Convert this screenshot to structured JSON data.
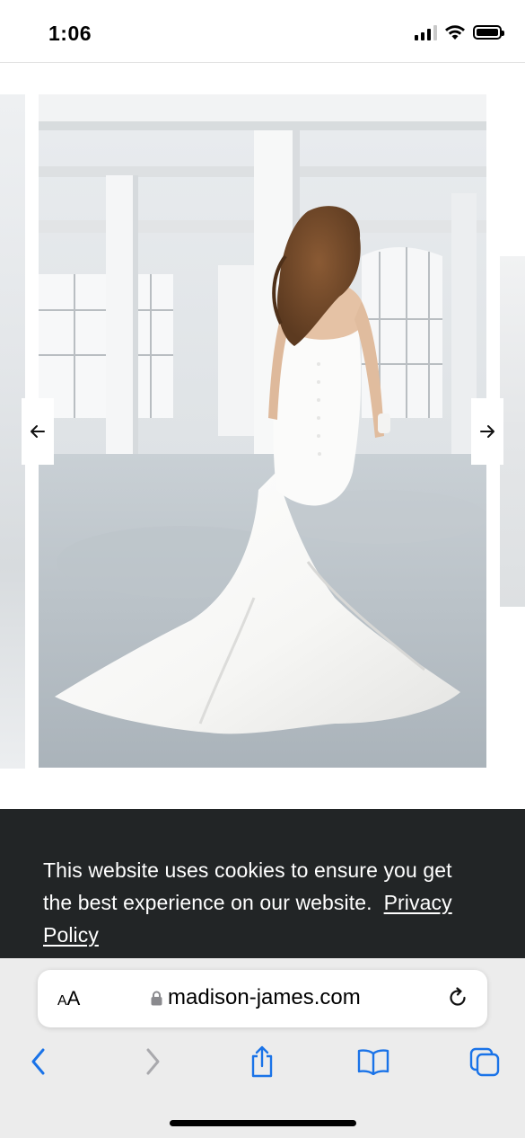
{
  "status_bar": {
    "time": "1:06",
    "icons": [
      "cellular-signal-icon",
      "wifi-icon",
      "battery-icon"
    ]
  },
  "carousel": {
    "image_subject": "Bride in white strapless mermaid wedding gown with long train, photographed from behind in a white industrial loft",
    "prev_arrow_icon": "arrow-left-icon",
    "next_arrow_icon": "arrow-right-icon"
  },
  "cookie_banner": {
    "message": "This website uses cookies to ensure you get the best experience on our website.",
    "link_text": "Privacy Policy",
    "background": "#222526"
  },
  "browser": {
    "aa_label_small": "A",
    "aa_label_large": "A",
    "url": "madison-james.com",
    "accent": "#1a73e8",
    "icons": {
      "lock": "lock-icon",
      "reload": "reload-icon",
      "back": "chevron-left-icon",
      "forward": "chevron-right-icon",
      "share": "share-icon",
      "bookmarks": "book-icon",
      "tabs": "tabs-icon"
    }
  }
}
